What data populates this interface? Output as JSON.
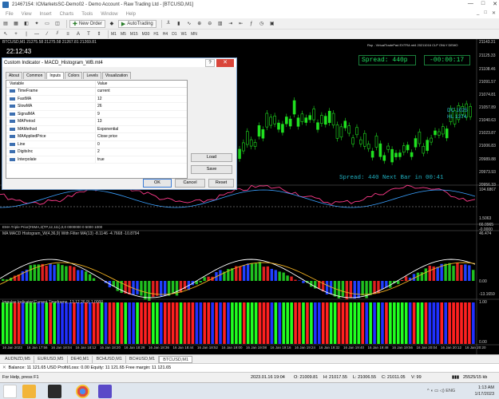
{
  "window": {
    "title": "21467154: ICMarketsSC-Demo02 - Demo Account - Raw Trading Ltd - [BTCUSD,M1]",
    "controls": [
      "—",
      "□",
      "✕"
    ]
  },
  "menu": {
    "items": [
      "File",
      "View",
      "Insert",
      "Charts",
      "Tools",
      "Window",
      "Help"
    ],
    "mdi_controls": [
      "_",
      "□",
      "✕"
    ]
  },
  "toolbar": {
    "new_order": "New Order",
    "autotrading": "AutoTrading",
    "timeframes": [
      "M1",
      "M5",
      "M15",
      "M30",
      "H1",
      "H4",
      "D1",
      "W1",
      "MN"
    ]
  },
  "chart": {
    "symbol_header": "BTCUSD,M1 21275.58 21275.58 21267.81 21269.81",
    "time_label": "22:12:43",
    "ea_label": "Rsp - VirtualTradePad EXTRA mt4 20211016 CLP ONLY DEMO",
    "spread_box": "Spread: 440p",
    "timer_box": "-00:00:17",
    "dc_line1": "DC 1025",
    "dc_line2": "HL 1374",
    "spread_next": "Spread: 440 Next Bar in 00:41",
    "price_axis": [
      "21143.31",
      "21125.33",
      "21108.46",
      "21091.57",
      "21074.81",
      "21057.89",
      "21040.63",
      "21023.87",
      "21006.83",
      "20989.88",
      "20973.93",
      "20956.33"
    ],
    "sub1_axis": [
      "104.6867",
      "1.5063",
      "66.0965",
      "-0.0000"
    ],
    "sub2_label": "EMA Triple Prior(#SMA,2(TP,12,111),0,0 0000000 0 5000 1000",
    "sub2_axis": [
      "66.0965"
    ],
    "sub3_label": "MA MACD Histogram_W(4,36,9) With Filter MA(13) -8.1146 -4.7668 -10.8794",
    "sub3_axis": [
      "46.474",
      "0.00",
      "-13.1659"
    ],
    "sub4_label": "Impulse Indicator(Current Timeframe, 13,12,26,9) 1.0000",
    "sub4_axis": [
      "1.00",
      "0.00"
    ],
    "time_axis": [
      "16 Jan 2023",
      "16 Jan 17:56",
      "16 Jan 18:04",
      "16 Jan 18:12",
      "16 Jan 18:20",
      "16 Jan 18:28",
      "16 Jan 18:36",
      "16 Jan 18:44",
      "16 Jan 18:52",
      "16 Jan 19:00",
      "16 Jan 19:08",
      "16 Jan 19:16",
      "16 Jan 19:24",
      "16 Jan 19:32",
      "16 Jan 19:40",
      "16 Jan 19:48",
      "16 Jan 19:56",
      "16 Jan 20:04",
      "16 Jan 20:12",
      "16 Jan 20:20"
    ]
  },
  "dialog": {
    "title": "Custom Indicator - MACD_Histogram_WB.mt4",
    "help": "?",
    "close": "✕",
    "tabs": [
      "About",
      "Common",
      "Inputs",
      "Colors",
      "Levels",
      "Visualization"
    ],
    "active_tab": "Inputs",
    "table_headers": [
      "Variable",
      "Value"
    ],
    "rows": [
      {
        "variable": "TimeFrame",
        "value": "current"
      },
      {
        "variable": "FastMA",
        "value": "12"
      },
      {
        "variable": "SlowMA",
        "value": "26"
      },
      {
        "variable": "SignalMA",
        "value": "9"
      },
      {
        "variable": "MAPeriod",
        "value": "13"
      },
      {
        "variable": "MAMethod",
        "value": "Exponential"
      },
      {
        "variable": "MAAppliedPrice",
        "value": "Close price"
      },
      {
        "variable": "Line",
        "value": "0"
      },
      {
        "variable": "DigitsInc",
        "value": "2"
      },
      {
        "variable": "Interpolate",
        "value": "true"
      }
    ],
    "load": "Load",
    "save": "Save",
    "ok": "OK",
    "cancel": "Cancel",
    "reset": "Reset"
  },
  "chart_tabs": [
    "AUDNZD,M5",
    "EURUSD,M5",
    "DE40,M1",
    "BCHUSD,M1",
    "BCHUSD,M1",
    "BTCUSD,M1"
  ],
  "active_chart_tab": "BTCUSD,M1",
  "balance": {
    "close": "✕",
    "text": "Balance: 11 121.65 USD  Profit/Loss: 0.00  Equity: 11 121.65  Free margin: 11 121.65"
  },
  "status": {
    "help": "For Help, press F1",
    "time": "2023.01.16 19:04",
    "open": "O: 21009.81",
    "high": "H: 21017.55",
    "low": "L: 21006.55",
    "close": "C: 21011.05",
    "volume": "V: 99",
    "traffic": "25525/15 kb"
  },
  "taskbar": {
    "clock_time": "1:13 AM",
    "clock_date": "1/17/2023",
    "tray": "^  ◖  ▭  ◁)  ENG"
  }
}
